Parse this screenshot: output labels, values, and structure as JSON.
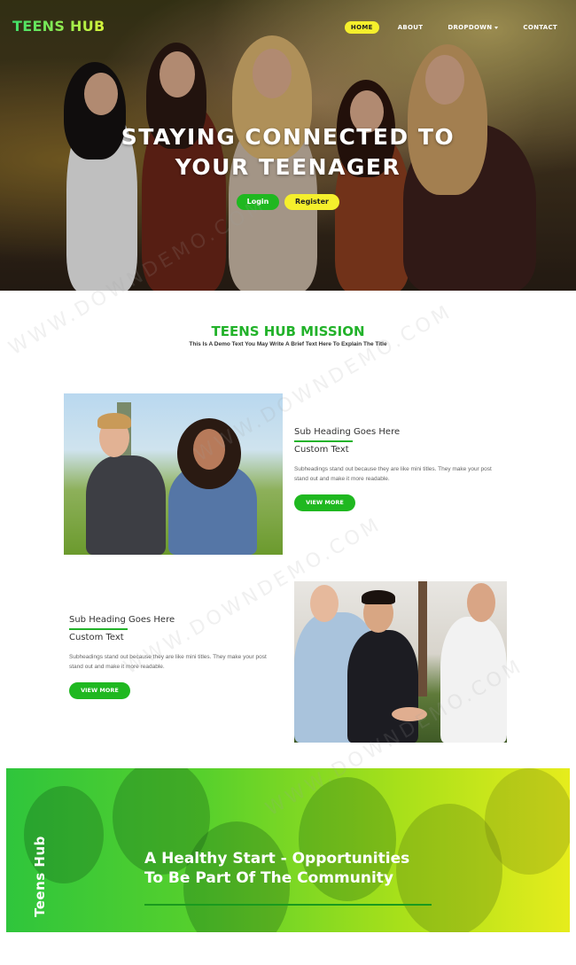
{
  "brand": "TEENS HUB",
  "nav": {
    "items": [
      {
        "label": "HOME",
        "active": true
      },
      {
        "label": "ABOUT"
      },
      {
        "label": "DROPDOWN",
        "has_caret": true
      },
      {
        "label": "CONTACT"
      }
    ]
  },
  "hero": {
    "title_line1": "STAYING CONNECTED TO",
    "title_line2": "YOUR TEENAGER",
    "login_label": "Login",
    "register_label": "Register"
  },
  "mission": {
    "title": "TEENS HUB MISSION",
    "subtitle": "This Is A Demo Text You May Write A Brief Text Here To Explain The Title"
  },
  "features": [
    {
      "heading": "Sub Heading Goes Here",
      "custom": "Custom Text",
      "body": "Subheadings stand out because they are like mini titles. They make your post stand out and make it more readable.",
      "button": "VIEW MORE"
    },
    {
      "heading": "Sub Heading Goes Here",
      "custom": "Custom Text",
      "body": "Subheadings stand out because they are like mini titles. They make your post stand out and make it more readable.",
      "button": "VIEW MORE"
    }
  ],
  "banner": {
    "side_text": "Teens Hub",
    "title_line1": "A Healthy Start - Opportunities",
    "title_line2": "To Be Part Of The Community"
  },
  "watermark": "WWW.DOWNDEMO.COM",
  "colors": {
    "accent_green": "#1fb820",
    "accent_yellow": "#f5ef2c",
    "title_green": "#22b22a"
  }
}
